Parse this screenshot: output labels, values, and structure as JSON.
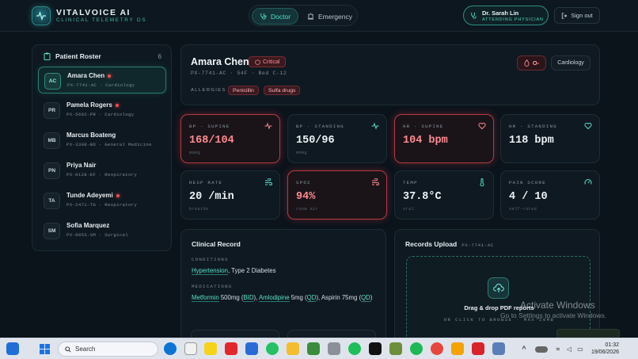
{
  "brand": {
    "name": "VITALVOICE AI",
    "subtitle": "CLINICAL TELEMETRY OS"
  },
  "roles": {
    "active": "Doctor",
    "inactive": "Emergency"
  },
  "user": {
    "name": "Dr. Sarah Lin",
    "role": "ATTENDING PHYSICIAN",
    "signout": "Sign out"
  },
  "roster": {
    "title": "Patient Roster",
    "count": "6",
    "patients": [
      {
        "initials": "AC",
        "name": "Amara Chen",
        "meta": "PX-7741-AC · Cardiology",
        "alert": true
      },
      {
        "initials": "PR",
        "name": "Pamela Rogers",
        "meta": "PX-5602-PR · Cardiology",
        "alert": true
      },
      {
        "initials": "MB",
        "name": "Marcus Boateng",
        "meta": "PX-3398-BO · General Medicine",
        "alert": false
      },
      {
        "initials": "PN",
        "name": "Priya Nair",
        "meta": "PX-0128-EF · Respiratory",
        "alert": false
      },
      {
        "initials": "TA",
        "name": "Tunde Adeyemi",
        "meta": "PX-2471-TG · Respiratory",
        "alert": true
      },
      {
        "initials": "SM",
        "name": "Sofia Marquez",
        "meta": "PX-8053-SM · Surgical",
        "alert": false
      }
    ]
  },
  "patient": {
    "name": "Amara Chen",
    "status": "Critical",
    "meta": "PX-7741-AC · 54F · Bed C-12",
    "allergies_label": "ALLERGIES",
    "allergies": [
      "Penicillin",
      "Sulfa drugs"
    ],
    "blood_type": "O-",
    "department": "Cardiology"
  },
  "vitals": [
    {
      "label": "BP · SUPINE",
      "value": "168/104",
      "unit": "mmHg",
      "critical": true,
      "icon": "pulse-icon"
    },
    {
      "label": "BP · STANDING",
      "value": "150/96",
      "unit": "mmHg",
      "critical": false,
      "icon": "pulse-icon"
    },
    {
      "label": "HR · SUPINE",
      "value": "104 bpm",
      "unit": "",
      "critical": true,
      "icon": "heart-icon"
    },
    {
      "label": "HR · STANDING",
      "value": "118 bpm",
      "unit": "",
      "critical": false,
      "icon": "heart-icon"
    },
    {
      "label": "RESP RATE",
      "value": "20 /min",
      "unit": "breaths",
      "critical": false,
      "icon": "wind-icon"
    },
    {
      "label": "SPO2",
      "value": "94%",
      "unit": "room air",
      "critical": true,
      "icon": "wind-icon"
    },
    {
      "label": "TEMP",
      "value": "37.8°C",
      "unit": "oral",
      "critical": false,
      "icon": "thermometer-icon"
    },
    {
      "label": "PAIN SCORE",
      "value": "4 / 10",
      "unit": "self-rated",
      "critical": false,
      "icon": "gauge-icon"
    }
  ],
  "clinical": {
    "title": "Clinical Record",
    "conditions_label": "CONDITIONS",
    "conditions": [
      "Hypertension",
      ", Type 2 Diabetes"
    ],
    "medications_label": "MEDICATIONS",
    "med_parts": [
      "Metformin",
      " 500mg (",
      "BID",
      "), ",
      "Amlodipine",
      " 5mg (",
      "QD",
      "), Aspirin 75mg (",
      "QD",
      ")"
    ]
  },
  "upload": {
    "title": "Records Upload",
    "code": "PX-7741-AC",
    "main": "Drag & drop PDF reports",
    "sub": "OR CLICK TO BROWSE · MAX 20MB"
  },
  "watermark": {
    "line1": "Activate Windows",
    "line2": "Go to Settings to activate Windows."
  },
  "taskbar": {
    "search": "Search",
    "time": "01:32",
    "date": "19/06/2026"
  },
  "colors": {
    "accent": "#4fe0c8",
    "critical": "#ff8a90",
    "background": "#0b131b"
  }
}
